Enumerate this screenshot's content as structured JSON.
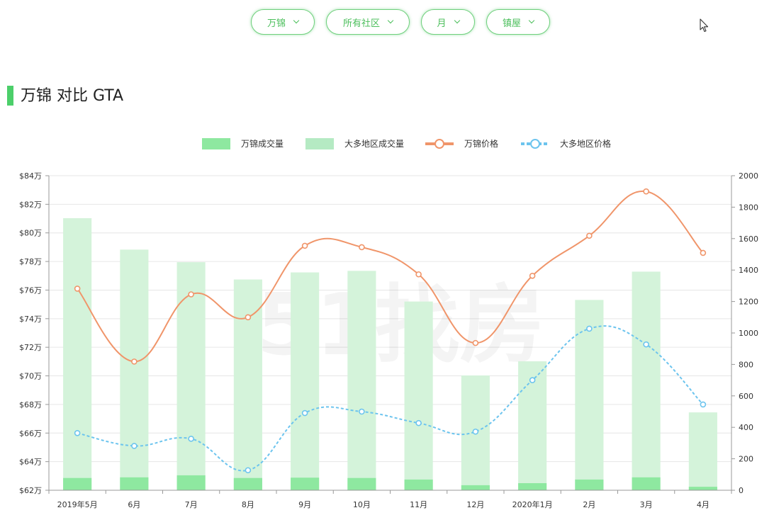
{
  "filters": [
    {
      "label": "万锦"
    },
    {
      "label": "所有社区"
    },
    {
      "label": "月"
    },
    {
      "label": "镇屋"
    }
  ],
  "section_title": "万锦 对比 GTA",
  "watermark": "51找房",
  "colors": {
    "accent": "#4ccf6a",
    "local_volume": "#8ee8a0",
    "region_volume": "#d4f3da",
    "local_price": "#f0956a",
    "region_price": "#6cc4ee"
  },
  "chart_data": {
    "type": "bar",
    "categories": [
      "2019年5月",
      "6月",
      "7月",
      "8月",
      "9月",
      "10月",
      "11月",
      "12月",
      "2020年1月",
      "2月",
      "3月",
      "4月"
    ],
    "legend": [
      "万锦成交量",
      "大多地区成交量",
      "万锦价格",
      "大多地区价格"
    ],
    "legend_position": "top",
    "y_left": {
      "min": 620000,
      "max": 840000,
      "ticks": [
        "$62万",
        "$64万",
        "$66万",
        "$68万",
        "$70万",
        "$72万",
        "$74万",
        "$76万",
        "$78万",
        "$80万",
        "$82万",
        "$84万"
      ]
    },
    "y_right": {
      "min": 0,
      "max": 2000,
      "ticks": [
        "0",
        "200",
        "400",
        "600",
        "800",
        "1000",
        "1200",
        "1400",
        "1600",
        "1800",
        "2000"
      ]
    },
    "grid": true,
    "series": [
      {
        "name": "万锦成交量",
        "type": "bar",
        "axis": "right",
        "values": [
          78,
          82,
          95,
          78,
          80,
          78,
          68,
          32,
          45,
          68,
          82,
          22
        ]
      },
      {
        "name": "大多地区成交量",
        "type": "bar",
        "axis": "right",
        "values": [
          1730,
          1530,
          1450,
          1340,
          1385,
          1395,
          1200,
          730,
          820,
          1210,
          1390,
          495
        ]
      },
      {
        "name": "万锦价格",
        "type": "line",
        "axis": "left",
        "values": [
          761000,
          710000,
          757000,
          741000,
          791000,
          790000,
          771000,
          723000,
          770000,
          798000,
          829000,
          786000
        ]
      },
      {
        "name": "大多地区价格",
        "type": "line",
        "axis": "left",
        "dashed": true,
        "values": [
          660000,
          651000,
          656000,
          634000,
          674000,
          675000,
          667000,
          661000,
          697000,
          733000,
          722000,
          680000
        ]
      }
    ]
  }
}
